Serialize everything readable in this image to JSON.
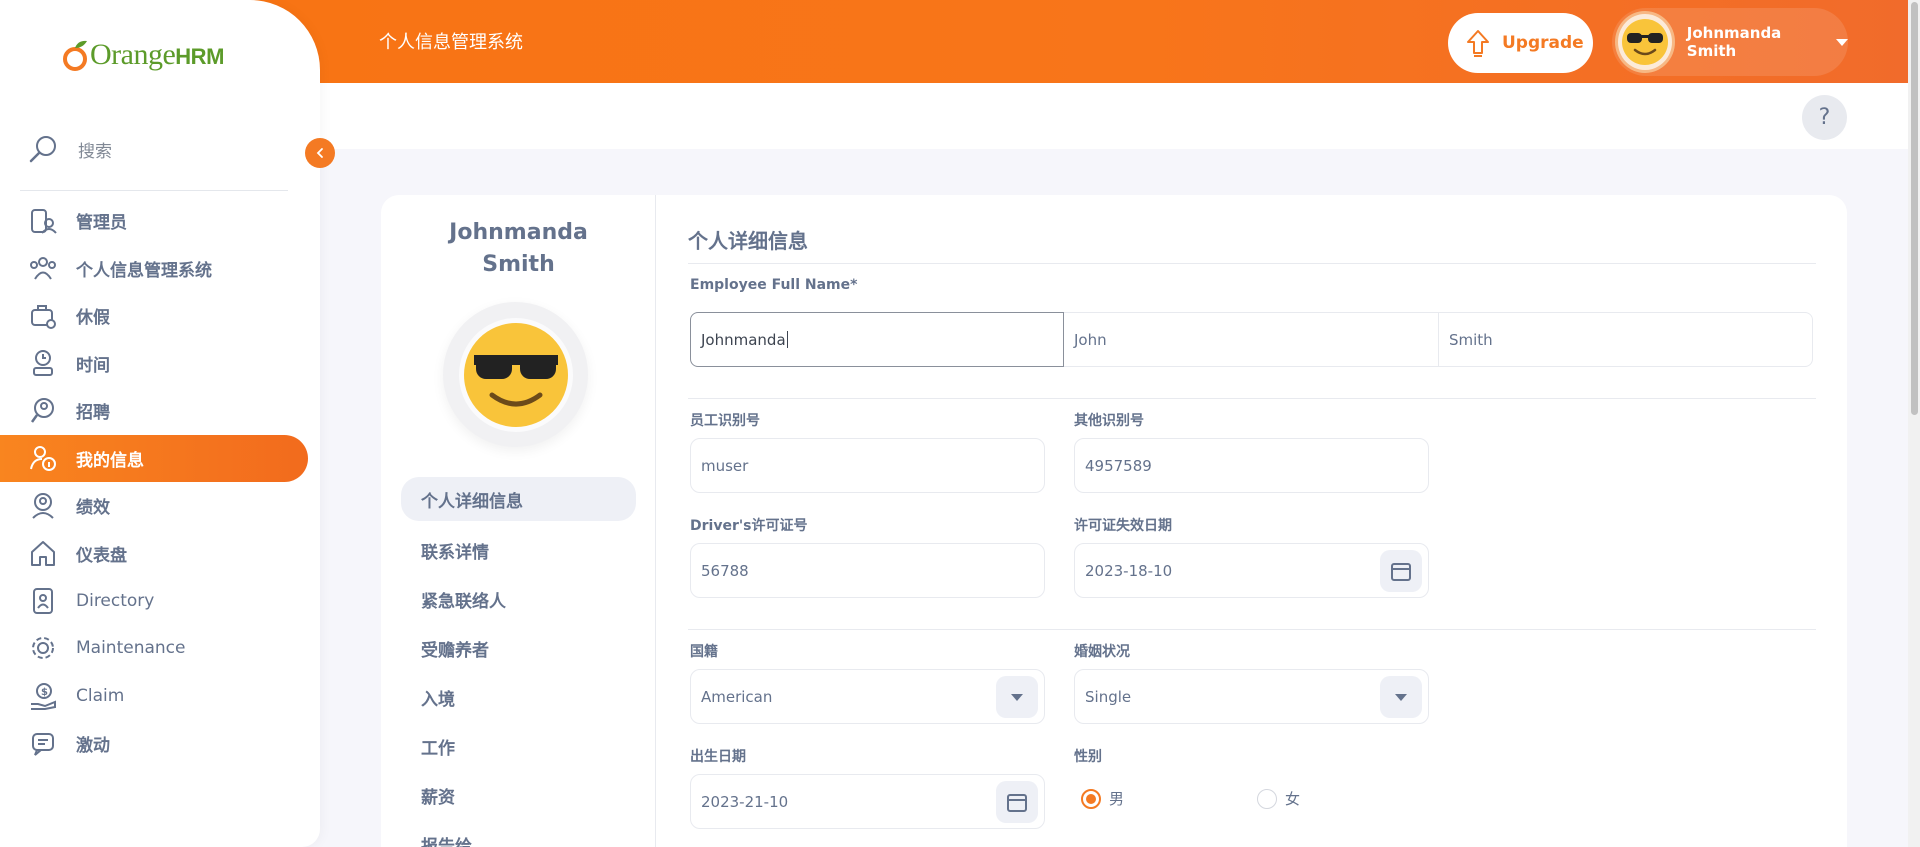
{
  "header": {
    "title": "个人信息管理系统",
    "upgrade_label": "Upgrade",
    "user_name": "Johnmanda Smith",
    "help_label": "?"
  },
  "sidebar": {
    "brand_orange": "Orange",
    "brand_hrm": "HRM",
    "search_placeholder": "搜索",
    "items": [
      {
        "label": "管理员",
        "icon": "admin-icon"
      },
      {
        "label": "个人信息管理系统",
        "icon": "pim-icon"
      },
      {
        "label": "休假",
        "icon": "leave-icon"
      },
      {
        "label": "时间",
        "icon": "time-icon"
      },
      {
        "label": "招聘",
        "icon": "recruitment-icon"
      },
      {
        "label": "我的信息",
        "icon": "my-info-icon",
        "active": true
      },
      {
        "label": "绩效",
        "icon": "performance-icon"
      },
      {
        "label": "仪表盘",
        "icon": "dashboard-icon"
      },
      {
        "label": "Directory",
        "icon": "directory-icon"
      },
      {
        "label": "Maintenance",
        "icon": "maintenance-icon"
      },
      {
        "label": "Claim",
        "icon": "claim-icon"
      },
      {
        "label": "激动",
        "icon": "buzz-icon"
      }
    ]
  },
  "profile": {
    "name_line1": "Johnmanda",
    "name_line2": "Smith",
    "tabs": [
      "个人详细信息",
      "联系详情",
      "紧急联络人",
      "受赡养者",
      "入境",
      "工作",
      "薪资",
      "报告给"
    ]
  },
  "form": {
    "section_title": "个人详细信息",
    "full_name_label": "Employee Full Name*",
    "first_name": "Johnmanda",
    "middle_name": "John",
    "last_name": "Smith",
    "employee_id_label": "员工识别号",
    "employee_id": "muser",
    "other_id_label": "其他识别号",
    "other_id": "4957589",
    "license_label": "Driver's许可证号",
    "license": "56788",
    "license_expiry_label": "许可证失效日期",
    "license_expiry": "2023-18-10",
    "nationality_label": "国籍",
    "nationality": "American",
    "marital_label": "婚姻状况",
    "marital": "Single",
    "dob_label": "出生日期",
    "dob": "2023-21-10",
    "gender_label": "性别",
    "gender_male": "男",
    "gender_female": "女",
    "gender_selected": "男"
  },
  "colors": {
    "accent": "#f47a23",
    "text": "#64728c"
  }
}
